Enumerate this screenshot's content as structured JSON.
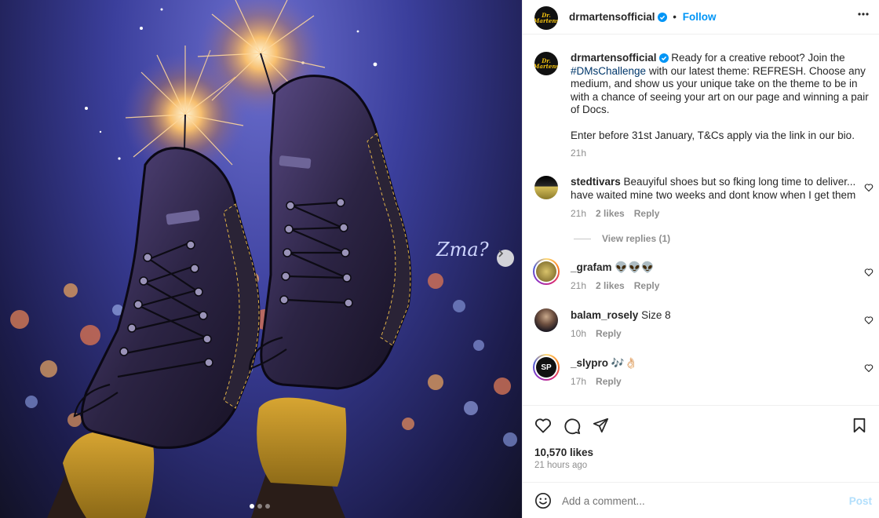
{
  "post": {
    "username": "drmartensofficial",
    "follow_label": "Follow",
    "separator": "•",
    "logo_text": "Dr. Martens",
    "caption": {
      "text_before": " Ready for a creative reboot? Join the ",
      "hashtag": "#DMsChallenge",
      "text_after": " with our latest theme: REFRESH. Choose any medium, and show us your unique take on the theme to be in with a chance of seeing your art on our page and winning a pair of Docs.",
      "paragraph2": "Enter before 31st January, T&Cs apply via the link in our bio.",
      "time": "21h"
    },
    "likes": "10,570 likes",
    "time_ago": "21 hours ago"
  },
  "media": {
    "carousel_dots": 3,
    "active_index": 0,
    "artist_signature": "Zma?"
  },
  "comments": [
    {
      "username": "stedtivars",
      "text": " Beauyiful shoes but so fking long time to deliver... have waited mine two weeks and dont know when I get them",
      "time": "21h",
      "likes": "2 likes",
      "reply": "Reply",
      "view_replies": "View replies (1)"
    },
    {
      "username": "_grafam",
      "text": " 👽👽👽",
      "time": "21h",
      "likes": "2 likes",
      "reply": "Reply"
    },
    {
      "username": "balam_rosely",
      "text": " Size 8",
      "time": "10h",
      "reply": "Reply"
    },
    {
      "username": "_slypro",
      "text": " 🎶👌🏻",
      "time": "17h",
      "reply": "Reply"
    }
  ],
  "add_comment": {
    "placeholder": "Add a comment...",
    "post_label": "Post"
  },
  "icons": {
    "heart": "heart-icon",
    "comment": "comment-icon",
    "share": "paper-plane-icon",
    "save": "bookmark-icon",
    "more": "more-options-icon",
    "emoji": "emoji-icon",
    "verified": "verified-badge-icon",
    "next": "chevron-right-icon"
  },
  "colors": {
    "link": "#0095f6",
    "hashtag": "#00376b",
    "muted": "#8e8e8e",
    "post_disabled": "#b2dffc"
  }
}
